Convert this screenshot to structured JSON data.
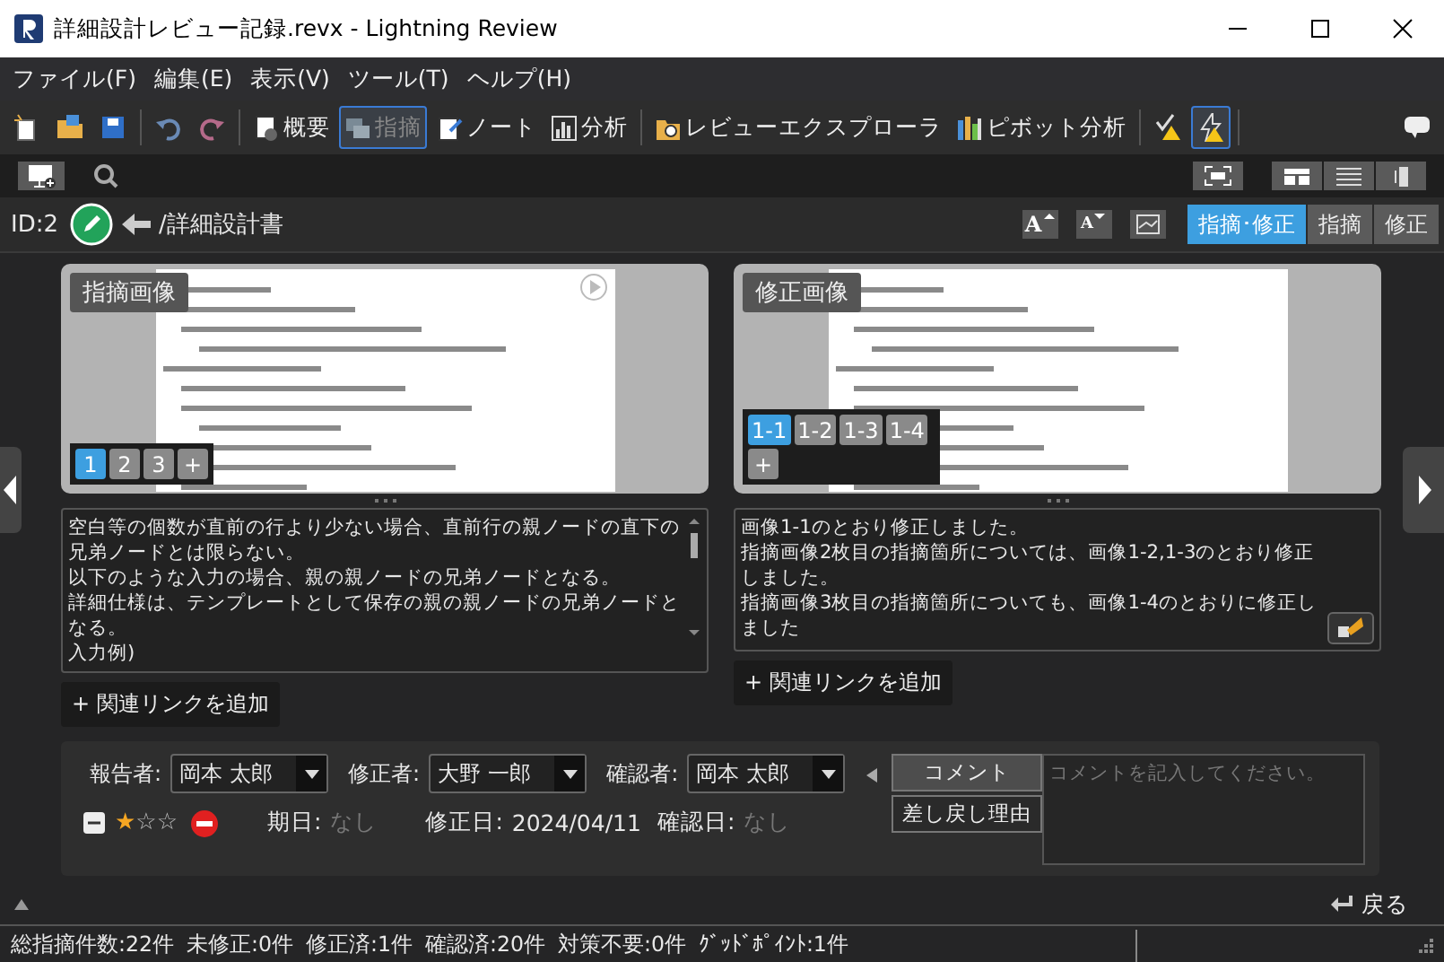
{
  "window": {
    "title": "詳細設計レビュー記録.revx  - Lightning Review"
  },
  "menu": [
    "ファイル(F)",
    "編集(E)",
    "表示(V)",
    "ツール(T)",
    "ヘルプ(H)"
  ],
  "toolbar": {
    "views": [
      {
        "kind": "overview",
        "label": "概要",
        "selected": false
      },
      {
        "kind": "issue",
        "label": "指摘",
        "selected": true
      },
      {
        "kind": "note",
        "label": "ノート",
        "selected": false
      },
      {
        "kind": "analysis",
        "label": "分析",
        "selected": false
      },
      {
        "kind": "explorer",
        "label": "レビューエクスプローラ",
        "selected": false
      },
      {
        "kind": "pivot",
        "label": "ピボット分析",
        "selected": false
      }
    ],
    "warning_toggle": {
      "on": true
    }
  },
  "id_row": {
    "id": "ID:2",
    "path": "/詳細設計書",
    "font_buttons": [
      {
        "kind": "larger",
        "label": "A"
      },
      {
        "kind": "smaller",
        "label": "A"
      }
    ],
    "view_modes": [
      {
        "label": "指摘･修正",
        "selected": true
      },
      {
        "label": "指摘",
        "selected": false
      },
      {
        "label": "修正",
        "selected": false
      }
    ]
  },
  "panels": [
    {
      "kind": "issue",
      "image_label": "指摘画像",
      "pages": [
        {
          "label": "1",
          "selected": true
        },
        {
          "label": "2",
          "selected": false
        },
        {
          "label": "3",
          "selected": false
        }
      ],
      "add_page": "+",
      "lines": [
        "空白等の個数が直前の行より少ない場合、直前行の親ノードの直下の兄弟ノードとは限らない。",
        "以下のような入力の場合、親の親ノードの兄弟ノードとなる。",
        "詳細仕様は、テンプレートとして保存の親の親ノードの兄弟ノードとなる。",
        "入力例)"
      ],
      "link_button": "+ 関連リンクを追加"
    },
    {
      "kind": "fix",
      "image_label": "修正画像",
      "pages": [
        {
          "label": "1-1",
          "selected": true
        },
        {
          "label": "1-2",
          "selected": false
        },
        {
          "label": "1-3",
          "selected": false
        },
        {
          "label": "1-4",
          "selected": false
        }
      ],
      "add_page": "+",
      "lines": [
        "画像1-1のとおり修正しました。",
        "指摘画像2枚目の指摘箇所については、画像1-2,1-3のとおり修正しました。",
        "指摘画像3枚目の指摘箇所についても、画像1-4のとおりに修正しました"
      ],
      "link_button": "+ 関連リンクを追加"
    }
  ],
  "details": {
    "people": [
      {
        "label": "報告者:",
        "value": "岡本 太郎"
      },
      {
        "label": "修正者:",
        "value": "大野 一郎"
      },
      {
        "label": "確認者:",
        "value": "岡本 太郎"
      }
    ],
    "stars": 1,
    "dates": [
      {
        "label": "期日:",
        "value": "なし",
        "empty": true
      },
      {
        "label": "修正日:",
        "value": "2024/04/11",
        "empty": false
      },
      {
        "label": "確認日:",
        "value": "なし",
        "empty": true
      }
    ],
    "comment_tabs": [
      {
        "label": "コメント",
        "selected": true
      },
      {
        "label": "差し戻し理由",
        "selected": false
      }
    ],
    "comment_placeholder": "コメントを記入してください。"
  },
  "back_button": "戻る",
  "status_bar": [
    "総指摘件数:22件",
    "未修正:0件",
    "修正済:1件",
    "確認済:20件",
    "対策不要:0件",
    "ｸﾞｯﾄﾞﾎﾟｲﾝﾄ:1件"
  ]
}
